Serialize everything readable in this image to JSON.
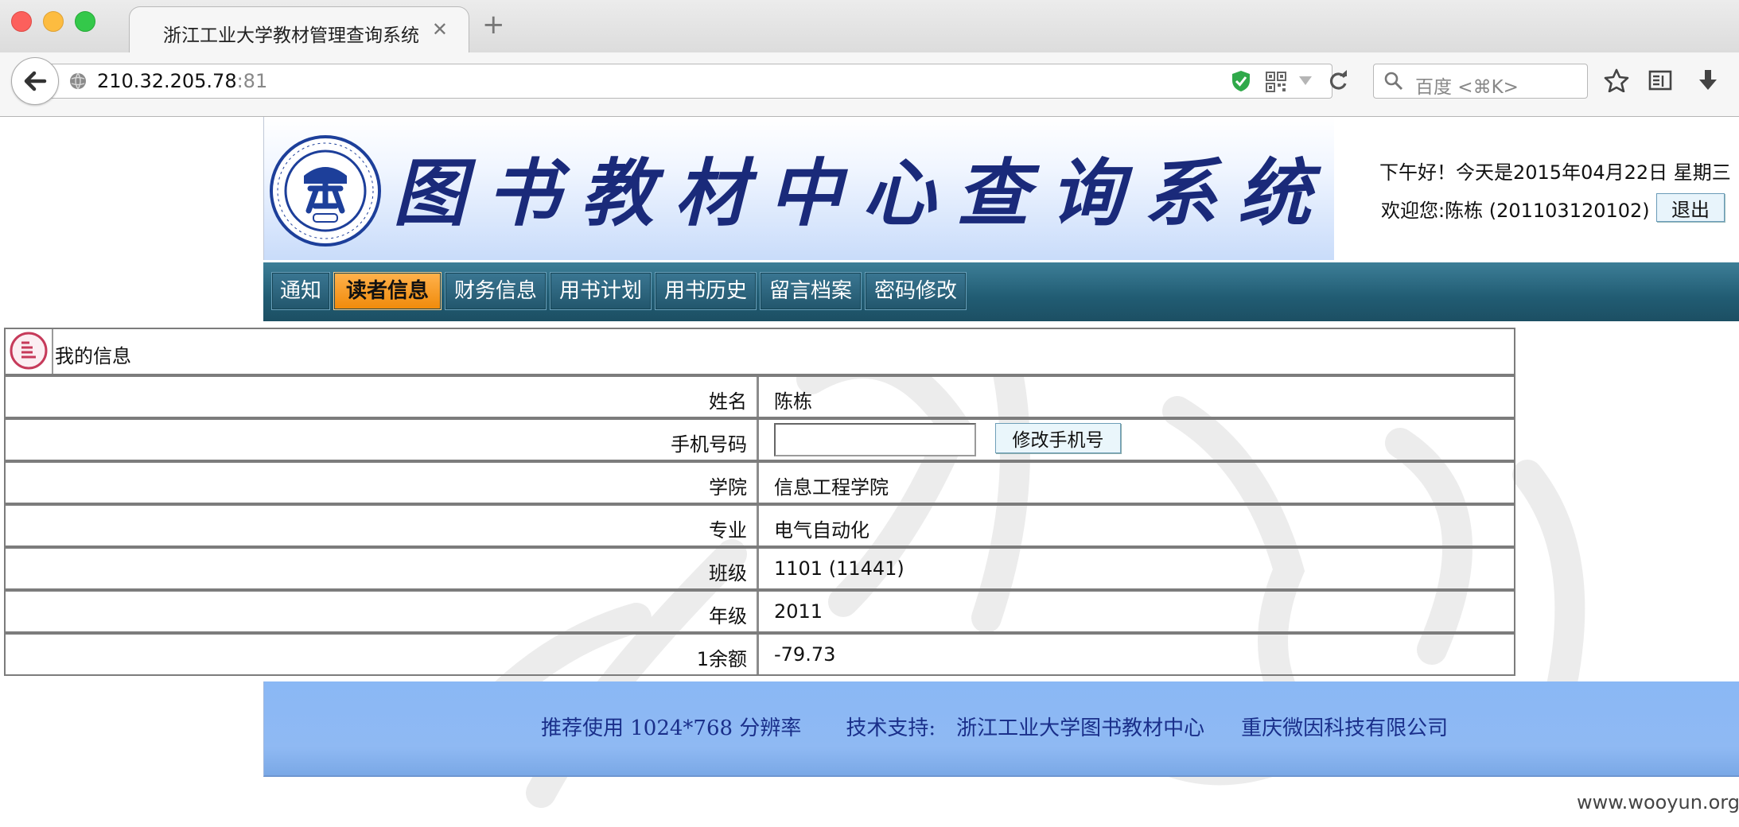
{
  "browser": {
    "tab_title": "浙江工业大学教材管理查询系统",
    "close_glyph": "✕",
    "new_tab_glyph": "+",
    "url_host": "210.32.205.78",
    "url_port": ":81",
    "search_placeholder": "百度 <⌘K>"
  },
  "banner": {
    "title": "图书教材中心查询系统",
    "greeting": "下午好！今天是2015年04月22日 星期三",
    "welcome": "欢迎您:陈栋 (201103120102)",
    "logout_label": "退出"
  },
  "menu": {
    "items": [
      {
        "label": "通知"
      },
      {
        "label": "读者信息"
      },
      {
        "label": "财务信息"
      },
      {
        "label": "用书计划"
      },
      {
        "label": "用书历史"
      },
      {
        "label": "留言档案"
      },
      {
        "label": "密码修改"
      }
    ],
    "active_index": 1
  },
  "info": {
    "header_title": "我的信息",
    "rows": [
      {
        "label": "姓名",
        "value": "陈栋"
      },
      {
        "label": "手机号码",
        "value": "",
        "button": "修改手机号"
      },
      {
        "label": "学院",
        "value": "信息工程学院"
      },
      {
        "label": "专业",
        "value": "电气自动化"
      },
      {
        "label": "班级",
        "value": "1101 (11441)"
      },
      {
        "label": "年级",
        "value": "2011"
      },
      {
        "label": "1余额",
        "value": "-79.73"
      }
    ]
  },
  "footer": {
    "resolution": "推荐使用 1024*768 分辨率",
    "support_label": "技术支持:",
    "org1": "浙江工业大学图书教材中心",
    "org2": "重庆微因科技有限公司"
  },
  "watermark_text": "www.wooyun.org",
  "colors": {
    "menu_bar": "#215c73",
    "menu_active": "#f08a0a",
    "footer_bg": "#8ab8f5",
    "title_text": "#1a2a7a"
  }
}
